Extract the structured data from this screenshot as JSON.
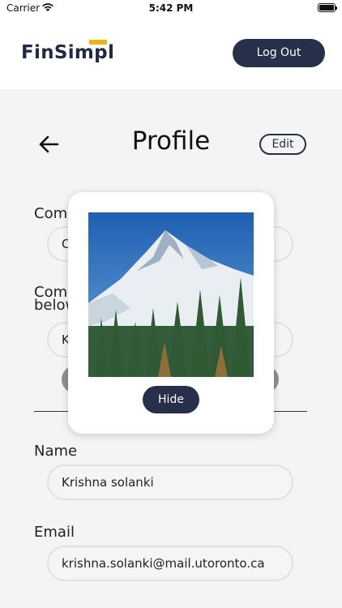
{
  "status_bar": {
    "carrier": "Carrier",
    "time": "5:42 PM"
  },
  "header": {
    "brand": "FinSimpl",
    "logout_label": "Log Out"
  },
  "profile": {
    "title": "Profile",
    "edit_label": "Edit"
  },
  "form": {
    "hidden_field_1": {
      "label": "Com",
      "value": "C"
    },
    "hidden_field_2": {
      "label": "Com below",
      "value": "K"
    },
    "name": {
      "label": "Name",
      "value": "Krishna solanki"
    },
    "email": {
      "label": "Email",
      "value": "krishna.solanki@mail.utoronto.ca"
    }
  },
  "modal": {
    "image_alt": "Snowy mountain peak with pine trees",
    "hide_label": "Hide"
  },
  "colors": {
    "primary": "#26304a",
    "accent": "#f1b218",
    "background": "#f5f4f4"
  },
  "icons": {
    "back": "arrow-left-icon",
    "wifi": "wifi-icon",
    "battery": "battery-icon"
  }
}
